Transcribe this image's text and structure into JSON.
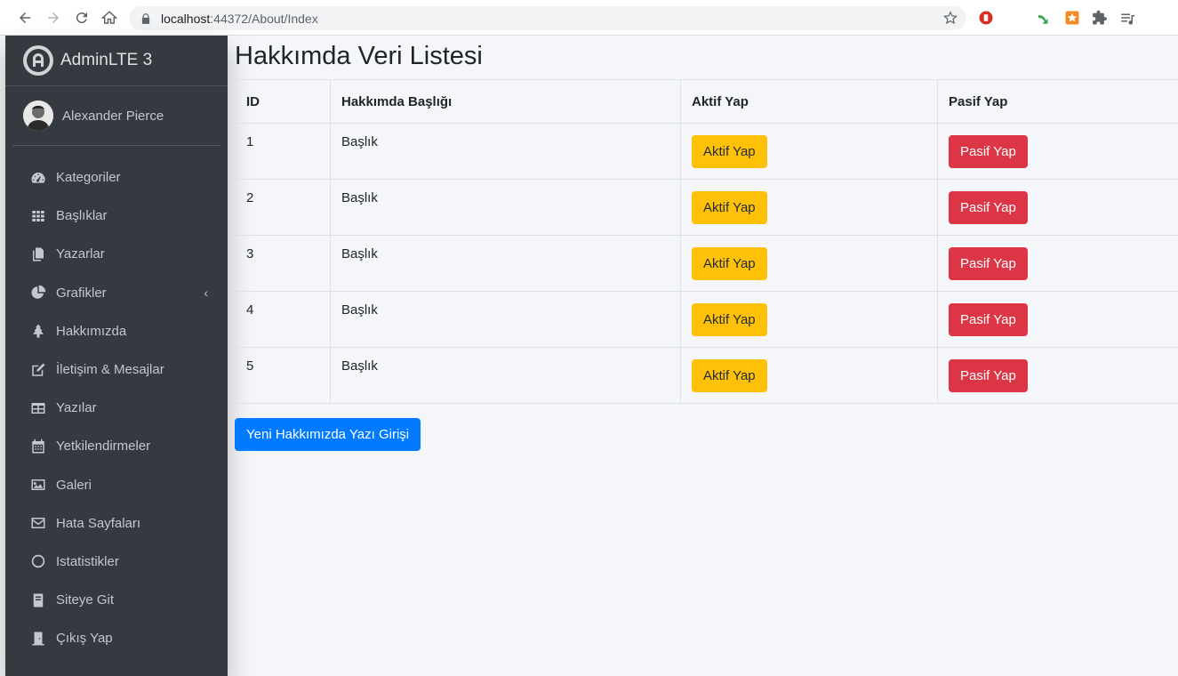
{
  "browser": {
    "url_host": "localhost",
    "url_path": ":44372/About/Index"
  },
  "sidebar": {
    "brand": "AdminLTE 3",
    "user_name": "Alexander Pierce",
    "items": [
      {
        "label": "Kategoriler",
        "icon": "tachometer-icon"
      },
      {
        "label": "Başlıklar",
        "icon": "grid-icon"
      },
      {
        "label": "Yazarlar",
        "icon": "copy-icon"
      },
      {
        "label": "Grafikler",
        "icon": "pie-chart-icon",
        "chevron": "‹"
      },
      {
        "label": "Hakkımızda",
        "icon": "tree-icon"
      },
      {
        "label": "İletişim & Mesajlar",
        "icon": "edit-icon"
      },
      {
        "label": "Yazılar",
        "icon": "table-icon"
      },
      {
        "label": "Yetkilendirmeler",
        "icon": "calendar-icon"
      },
      {
        "label": "Galeri",
        "icon": "image-icon"
      },
      {
        "label": "Hata Sayfaları",
        "icon": "envelope-icon"
      },
      {
        "label": "Istatistikler",
        "icon": "circle-icon"
      },
      {
        "label": "Siteye Git",
        "icon": "book-icon"
      },
      {
        "label": "Çıkış Yap",
        "icon": "door-icon"
      }
    ]
  },
  "main": {
    "title": "Hakkımda Veri Listesi",
    "table": {
      "headers": [
        "ID",
        "Hakkımda Başlığı",
        "Aktif Yap",
        "Pasif Yap"
      ],
      "rows": [
        {
          "id": "1",
          "title": "Başlık",
          "active_label": "Aktif Yap",
          "passive_label": "Pasif Yap"
        },
        {
          "id": "2",
          "title": "Başlık",
          "active_label": "Aktif Yap",
          "passive_label": "Pasif Yap"
        },
        {
          "id": "3",
          "title": "Başlık",
          "active_label": "Aktif Yap",
          "passive_label": "Pasif Yap"
        },
        {
          "id": "4",
          "title": "Başlık",
          "active_label": "Aktif Yap",
          "passive_label": "Pasif Yap"
        },
        {
          "id": "5",
          "title": "Başlık",
          "active_label": "Aktif Yap",
          "passive_label": "Pasif Yap"
        }
      ]
    },
    "new_button_label": "Yeni Hakkımızda Yazı Girişi"
  },
  "colors": {
    "sidebar_bg": "#343a40",
    "warning": "#ffc107",
    "danger": "#dc3545",
    "primary": "#007bff"
  }
}
